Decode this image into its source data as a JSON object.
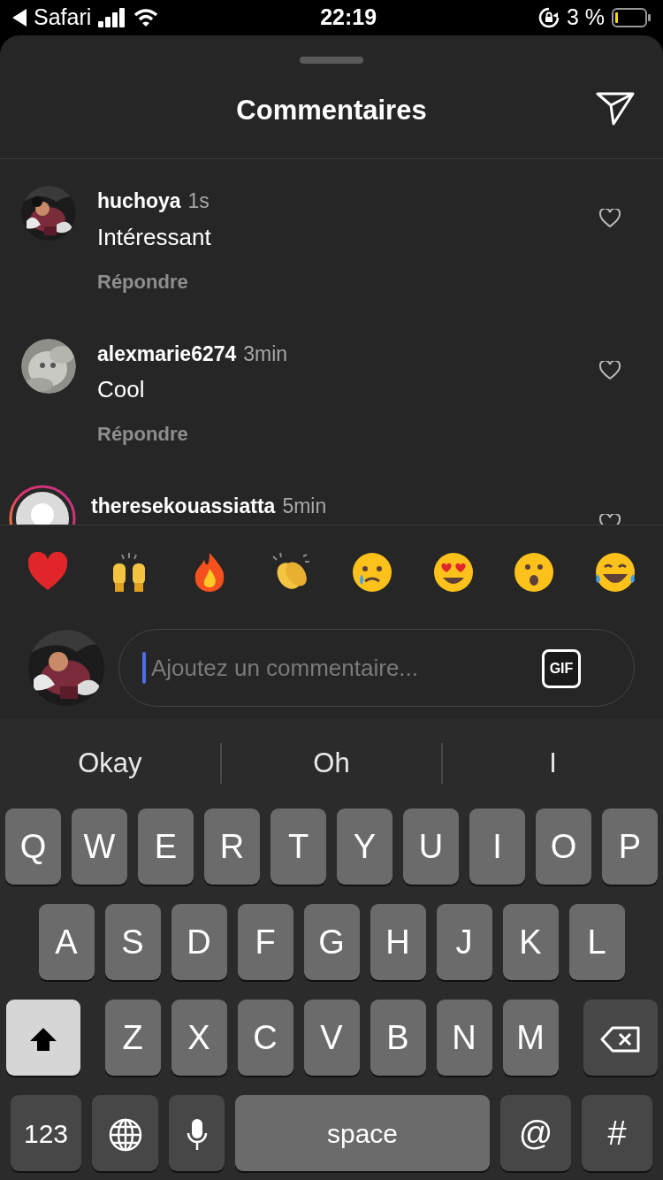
{
  "status_bar": {
    "back_app": "Safari",
    "time": "22:19",
    "battery": "3 %"
  },
  "sheet": {
    "title": "Commentaires"
  },
  "comments": [
    {
      "user": "huchoya",
      "time": "1s",
      "text": "Intéressant",
      "reply": "Répondre",
      "kind": "picture",
      "story_ring": false
    },
    {
      "user": "alexmarie6274",
      "time": "3min",
      "text": "Cool",
      "reply": "Répondre",
      "kind": "picture",
      "story_ring": false
    },
    {
      "user": "theresekouassiatta",
      "time": "5min",
      "kind": "default",
      "story_ring": true
    }
  ],
  "composer": {
    "placeholder": "Ajoutez un commentaire...",
    "gif": "GIF"
  },
  "suggestions": [
    "Okay",
    "Oh",
    "I"
  ],
  "keyboard": {
    "rows": [
      [
        "Q",
        "W",
        "E",
        "R",
        "T",
        "Y",
        "U",
        "I",
        "O",
        "P"
      ],
      [
        "A",
        "S",
        "D",
        "F",
        "G",
        "H",
        "J",
        "K",
        "L"
      ],
      [
        "Z",
        "X",
        "C",
        "V",
        "B",
        "N",
        "M"
      ]
    ],
    "shift_on": true,
    "numbers": "123",
    "space": "space",
    "at": "@",
    "hash": "#"
  }
}
